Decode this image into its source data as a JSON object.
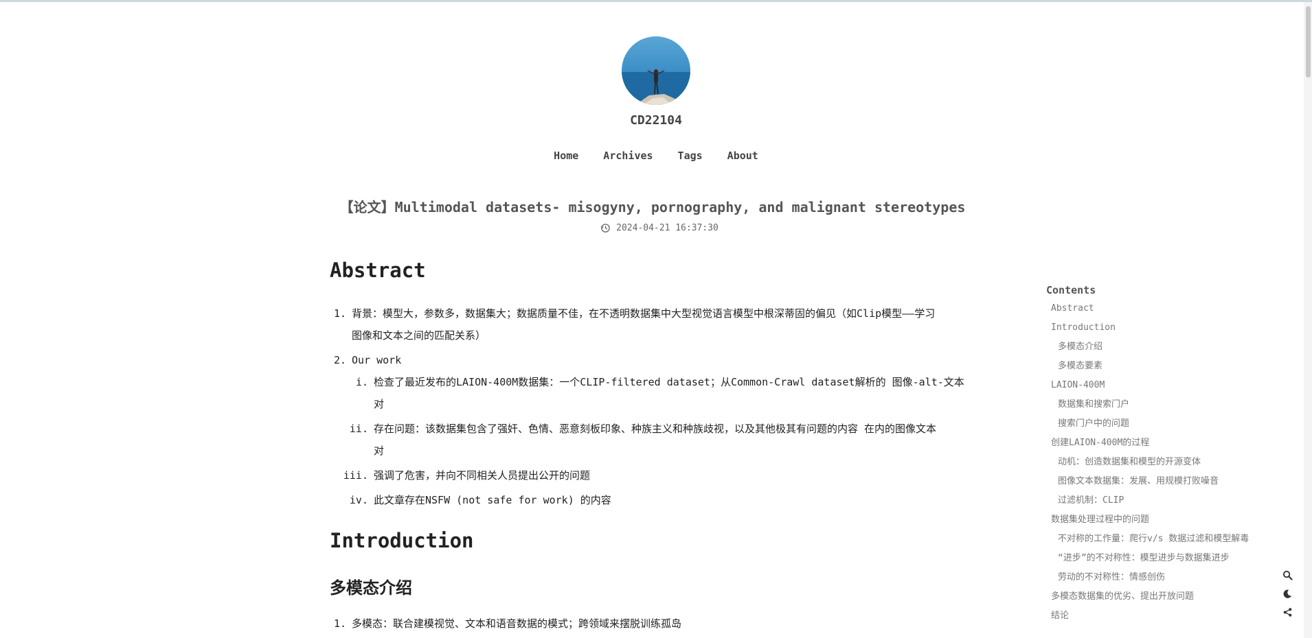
{
  "site": {
    "title": "CD22104",
    "avatar_alt": "avatar"
  },
  "nav": [
    {
      "label": "Home"
    },
    {
      "label": "Archives"
    },
    {
      "label": "Tags"
    },
    {
      "label": "About"
    }
  ],
  "post": {
    "title": "【论文】Multimodal datasets- misogyny, pornography, and malignant stereotypes",
    "date": "2024-04-21 16:37:30",
    "date_icon": "history-icon"
  },
  "content": {
    "abstract_heading": "Abstract",
    "abstract_items": [
      {
        "num": "1.",
        "text": "背景：模型大，参数多，数据集大；数据质量不佳，在不透明数据集中大型视觉语言模型中根深蒂固的偏见（如Clip模型——学习",
        "cont": "图像和文本之间的匹配关系）"
      },
      {
        "num": "2.",
        "text": "Our work"
      }
    ],
    "our_work_items": [
      {
        "num": "i.",
        "text": "检查了最近发布的LAION-400M数据集：一个CLIP-filtered dataset；从Common-Crawl dataset解析的 图像-alt-文本",
        "cont": "对"
      },
      {
        "num": "ii.",
        "text": "存在问题：该数据集包含了强奸、色情、恶意刻板印象、种族主义和种族歧视，以及其他极其有问题的内容 在内的图像文本",
        "cont": "对"
      },
      {
        "num": "iii.",
        "text": "强调了危害，并向不同相关人员提出公开的问题"
      },
      {
        "num": "iv.",
        "text": "此文章存在NSFW (not safe for work) 的内容"
      }
    ],
    "intro_heading": "Introduction",
    "multimodal_heading": "多模态介绍",
    "multimodal_items": [
      {
        "num": "1.",
        "text": "多模态：联合建模视觉、文本和语音数据的模式；跨领域来摆脱训练孤岛"
      }
    ]
  },
  "toc": {
    "title": "Contents",
    "items": [
      {
        "label": "Abstract",
        "level": 1
      },
      {
        "label": "Introduction",
        "level": 1
      },
      {
        "label": "多模态介绍",
        "level": 2
      },
      {
        "label": "多模态要素",
        "level": 2
      },
      {
        "label": "LAION-400M",
        "level": 1
      },
      {
        "label": "数据集和搜索门户",
        "level": 2
      },
      {
        "label": "搜索门户中的问题",
        "level": 2
      },
      {
        "label": "创建LAION-400M的过程",
        "level": 1
      },
      {
        "label": "动机：创造数据集和模型的开源变体",
        "level": 2
      },
      {
        "label": "图像文本数据集：发展、用规模打败噪音",
        "level": 2
      },
      {
        "label": "过滤机制：CLIP",
        "level": 2
      },
      {
        "label": "数据集处理过程中的问题",
        "level": 1
      },
      {
        "label": "不对称的工作量：爬行v/s 数据过滤和模型解毒",
        "level": 2
      },
      {
        "label": "“进步”的不对称性：模型进步与数据集进步",
        "level": 2
      },
      {
        "label": "劳动的不对称性：情感创伤",
        "level": 2
      },
      {
        "label": "多模态数据集的优劣、提出开放问题",
        "level": 1
      },
      {
        "label": "结论",
        "level": 1
      }
    ]
  },
  "tools": [
    "search-icon",
    "dark-mode-icon",
    "share-icon"
  ],
  "colors": {
    "top_border": "#c9d9dc",
    "text": "#222222",
    "muted": "#777777"
  }
}
